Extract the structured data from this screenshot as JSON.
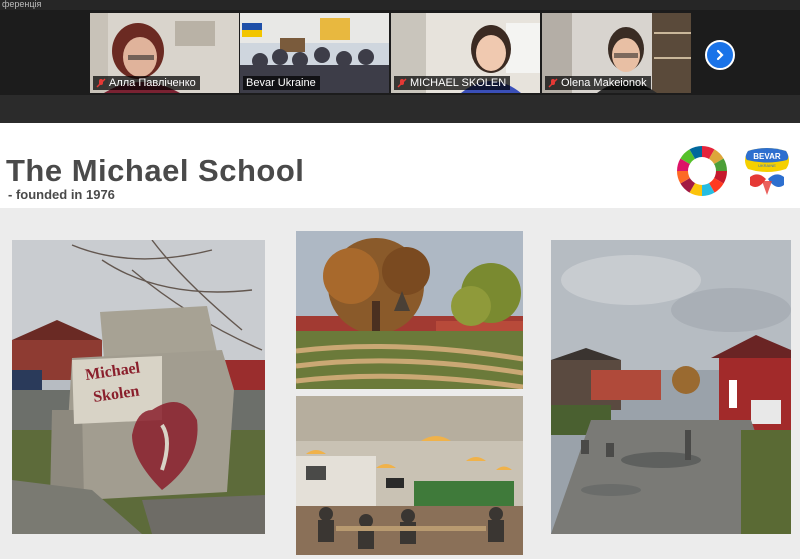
{
  "window": {
    "title_fragment": "ференція"
  },
  "participants": [
    {
      "name": "Алла Павліченко",
      "muted": true,
      "active": false
    },
    {
      "name": "Bevar Ukraine",
      "muted": false,
      "active": false
    },
    {
      "name": "MICHAEL SKOLEN",
      "muted": true,
      "active": true
    },
    {
      "name": "Olena Makeionok",
      "muted": true,
      "active": false
    }
  ],
  "gallery": {
    "next_icon": "chevron-right-icon"
  },
  "slide": {
    "title": "The Michael School",
    "subtitle": "- founded in 1976",
    "logos": {
      "sdg": "sdg-wheel-logo",
      "bevar": "BEVAR",
      "bevar_sub": "UKRAINE"
    },
    "stone_sign": {
      "line1": "Michael",
      "line2": "Skolen"
    },
    "photos": [
      "stone-sign-photo",
      "autumn-tree-amphitheater-photo",
      "classroom-photo",
      "school-yard-photo"
    ]
  },
  "colors": {
    "accent_blue": "#1a73e8",
    "active_border": "#7ed957",
    "title_gray": "#4a4a4a"
  }
}
